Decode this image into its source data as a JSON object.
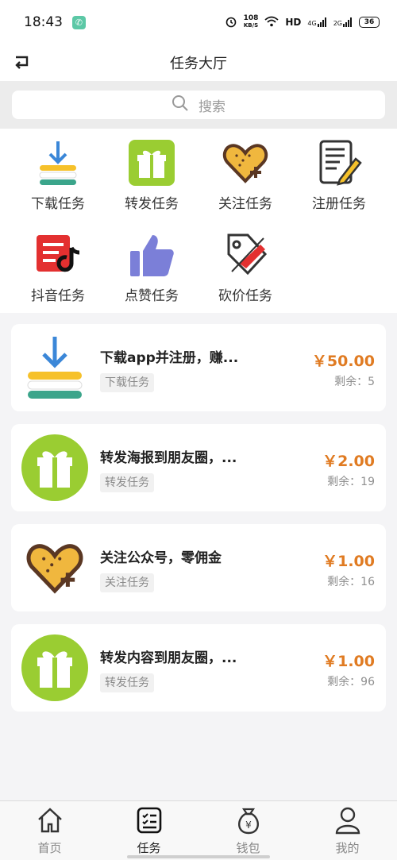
{
  "status_bar": {
    "time": "18:43",
    "net_speed_value": "108",
    "net_speed_unit": "KB/S",
    "hd_label": "HD",
    "signal1": "4G",
    "signal2": "2G",
    "battery": "36"
  },
  "header": {
    "title": "任务大厅"
  },
  "search": {
    "placeholder": "搜索"
  },
  "categories": [
    {
      "label": "下载任务",
      "icon": "download-icon"
    },
    {
      "label": "转发任务",
      "icon": "gift-icon"
    },
    {
      "label": "关注任务",
      "icon": "heart-plus-icon"
    },
    {
      "label": "注册任务",
      "icon": "register-icon"
    },
    {
      "label": "抖音任务",
      "icon": "tiktok-icon"
    },
    {
      "label": "点赞任务",
      "icon": "thumbs-up-icon"
    },
    {
      "label": "砍价任务",
      "icon": "bargain-tag-icon"
    }
  ],
  "tasks": [
    {
      "name": "下载app并注册，赚...",
      "tag": "下载任务",
      "price": "￥50.00",
      "remaining": "剩余：5",
      "icon": "download-icon"
    },
    {
      "name": "转发海报到朋友圈，...",
      "tag": "转发任务",
      "price": "￥2.00",
      "remaining": "剩余：19",
      "icon": "gift-icon"
    },
    {
      "name": "关注公众号，零佣金",
      "tag": "关注任务",
      "price": "￥1.00",
      "remaining": "剩余：16",
      "icon": "heart-plus-icon"
    },
    {
      "name": "转发内容到朋友圈，...",
      "tag": "转发任务",
      "price": "￥1.00",
      "remaining": "剩余：96",
      "icon": "gift-icon"
    }
  ],
  "tabbar": [
    {
      "label": "首页",
      "icon": "home-icon"
    },
    {
      "label": "任务",
      "icon": "task-list-icon"
    },
    {
      "label": "钱包",
      "icon": "wallet-icon"
    },
    {
      "label": "我的",
      "icon": "profile-icon"
    }
  ],
  "colors": {
    "accent_price": "#e07b22",
    "gift_green": "#9acd32",
    "thumb_purple": "#7b7fd8"
  }
}
